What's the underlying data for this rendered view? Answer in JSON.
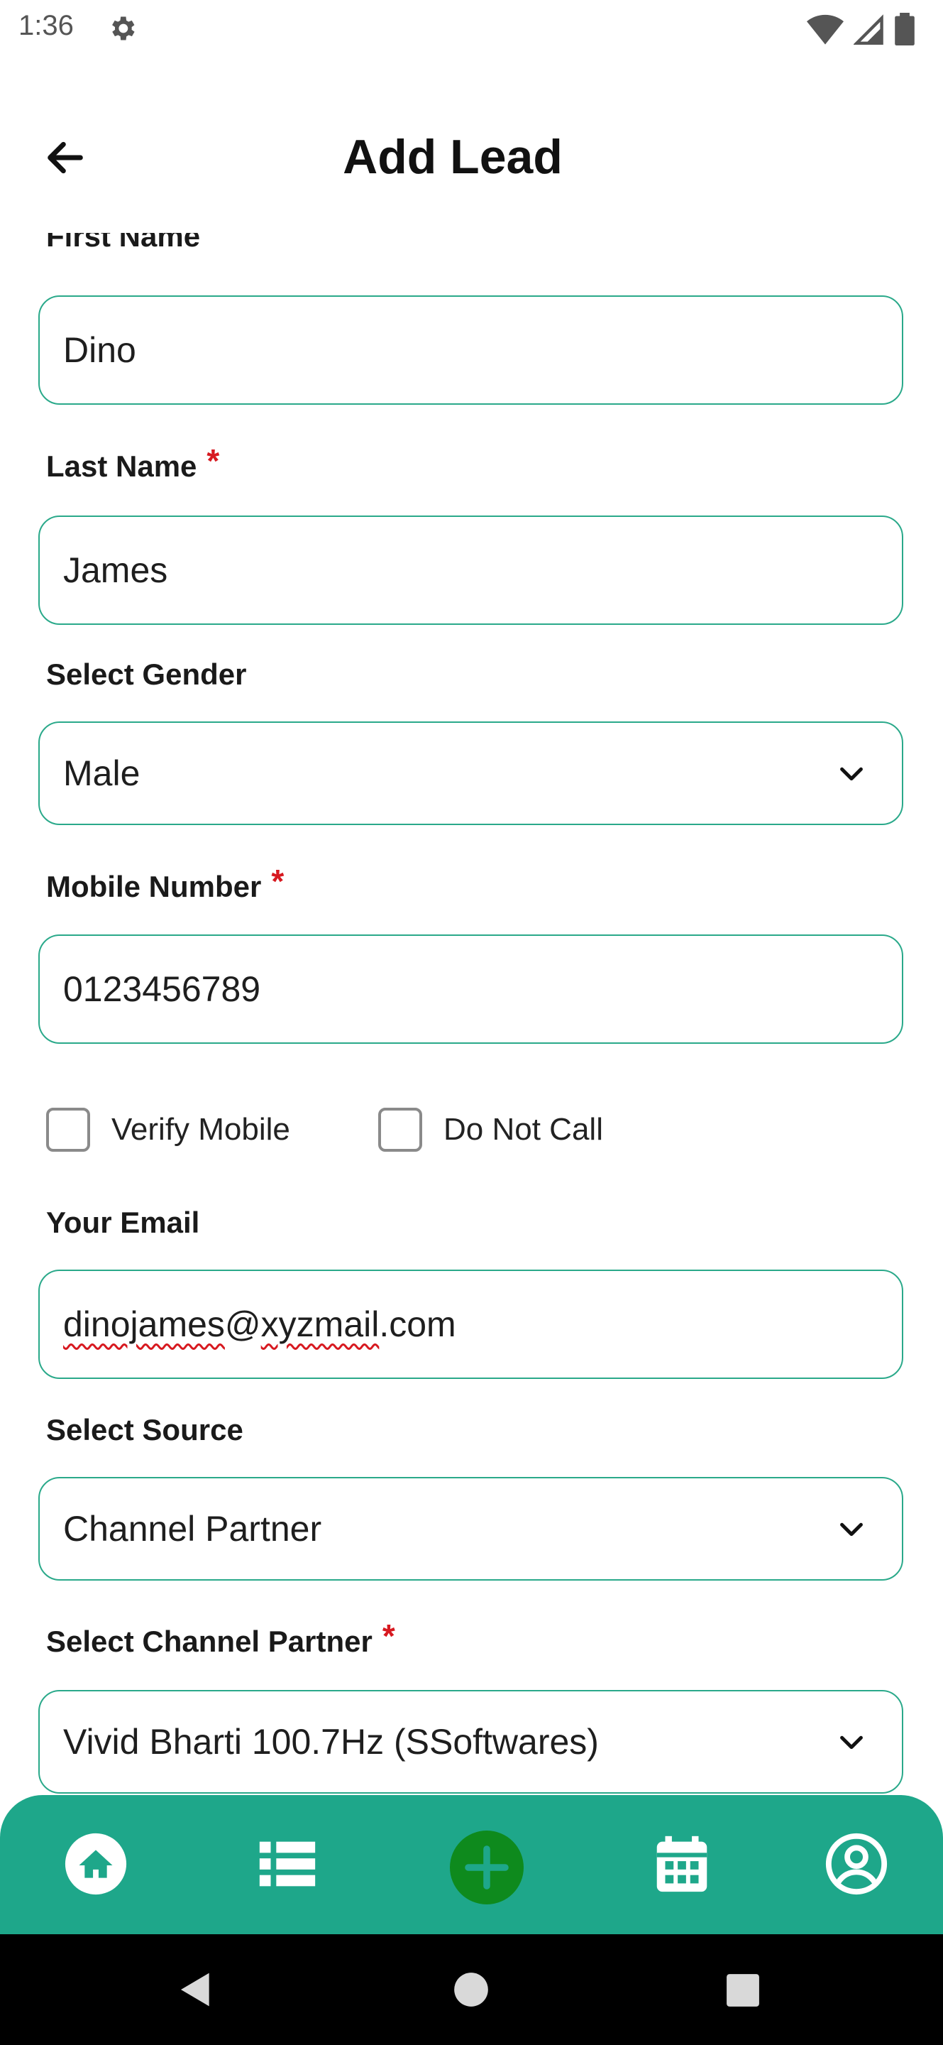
{
  "status": {
    "time": "1:36"
  },
  "header": {
    "title": "Add Lead"
  },
  "form": {
    "first_name": {
      "label": "First Name",
      "required_mark": "*",
      "value": "Dino"
    },
    "last_name": {
      "label": "Last Name",
      "required_mark": "*",
      "value": "James"
    },
    "gender": {
      "label": "Select Gender",
      "value": "Male"
    },
    "mobile": {
      "label": "Mobile Number",
      "required_mark": "*",
      "value": "0123456789"
    },
    "verify_mobile": {
      "label": "Verify Mobile",
      "checked": false
    },
    "do_not_call": {
      "label": "Do Not Call",
      "checked": false
    },
    "email": {
      "label": "Your Email",
      "value_part1": "dinojames",
      "value_at": "@",
      "value_part2": "xyzmail",
      "value_part3": ".com"
    },
    "source": {
      "label": "Select Source",
      "value": "Channel Partner"
    },
    "channel_partner": {
      "label": "Select Channel Partner",
      "required_mark": "*",
      "value": "Vivid Bharti 100.7Hz (SSoftwares)"
    }
  },
  "nav": {
    "items": [
      "home-icon",
      "list-icon",
      "add-icon",
      "calendar-icon",
      "profile-icon"
    ],
    "accent": "#1ea78a",
    "add_color": "#0e8a1d"
  },
  "colors": {
    "field_border": "#2aa98a",
    "required": "#d71920"
  }
}
